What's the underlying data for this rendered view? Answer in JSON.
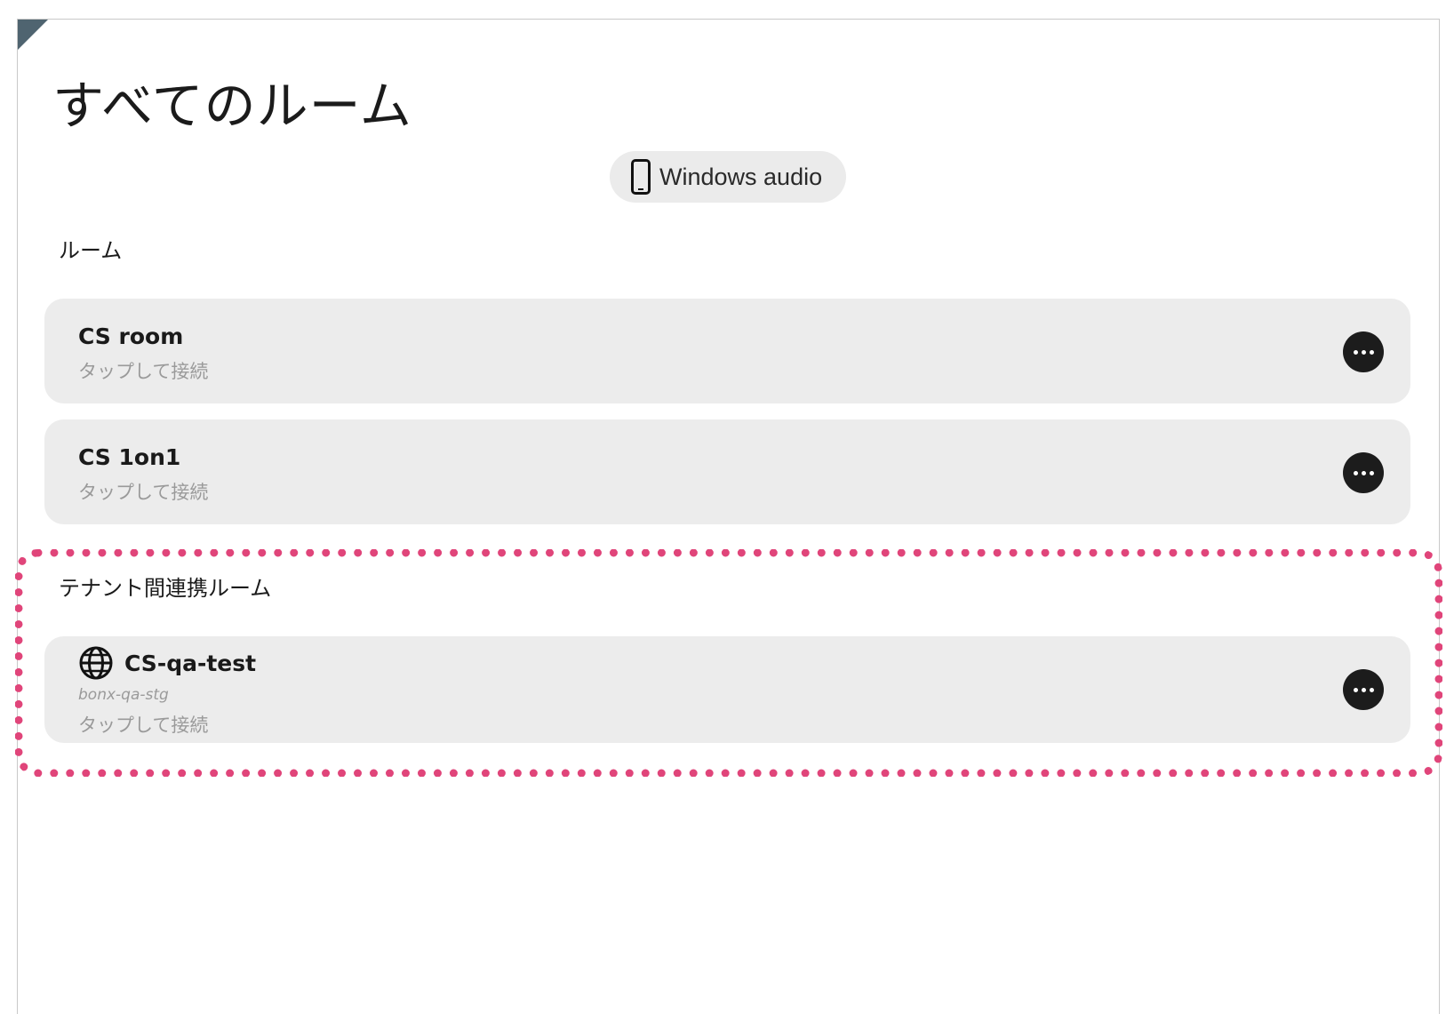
{
  "page": {
    "title": "すべてのルーム"
  },
  "device": {
    "icon": "phone-icon",
    "label": "Windows audio"
  },
  "sections": {
    "rooms_label": "ルーム",
    "tenant_label": "テナント間連携ルーム"
  },
  "rooms": [
    {
      "name": "CS room",
      "subtitle": "タップして接続",
      "more_icon": "more-icon"
    },
    {
      "name": "CS 1on1",
      "subtitle": "タップして接続",
      "more_icon": "more-icon"
    }
  ],
  "tenant_rooms": [
    {
      "icon": "globe-icon",
      "name": "CS-qa-test",
      "org": "bonx-qa-stg",
      "subtitle": "タップして接続",
      "more_icon": "more-icon"
    }
  ],
  "colors": {
    "highlight": "#e0457a",
    "card_bg": "#ececec",
    "corner_mark": "#4f6470"
  }
}
